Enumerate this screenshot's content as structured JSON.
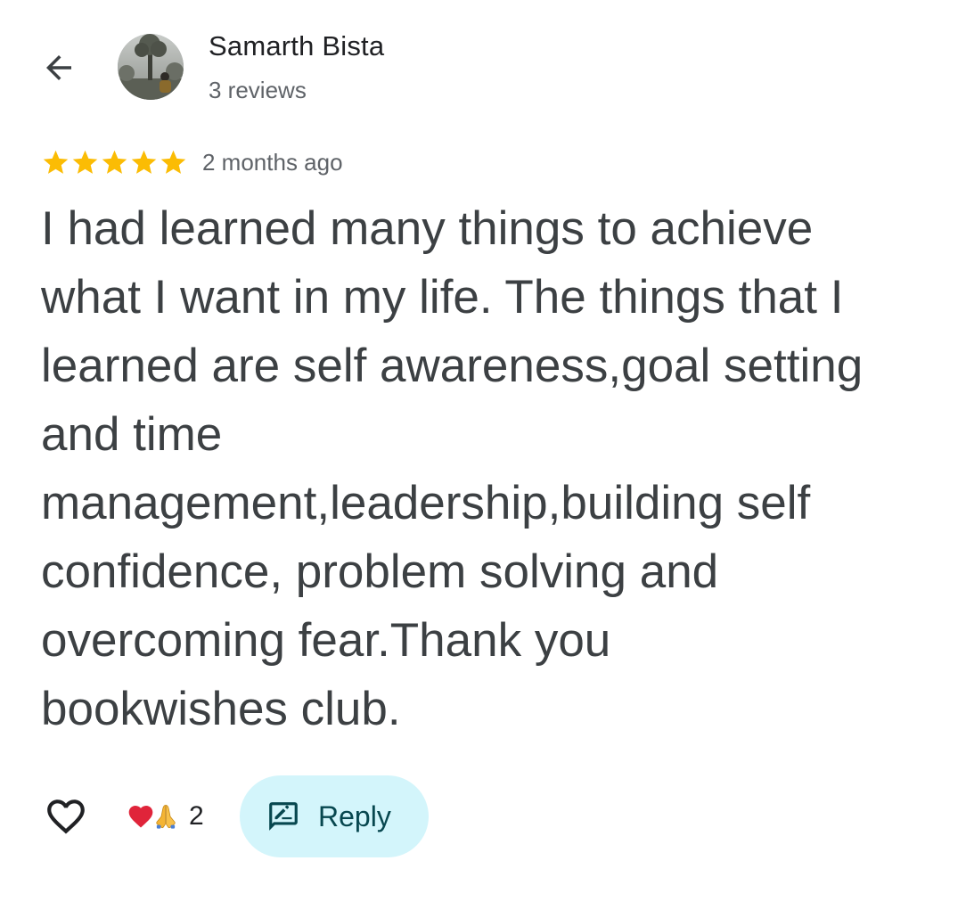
{
  "header": {
    "back_icon": "arrow-left-icon",
    "author_name": "Samarth Bista",
    "review_count": "3 reviews",
    "avatar_icon": "profile-photo"
  },
  "review": {
    "rating": 5,
    "rating_max": 5,
    "star_color": "#fbbc04",
    "date": "2 months ago",
    "text": "I had learned many things to achieve\nwhat I want in my life. The things that I\nlearned are self awareness,goal setting\nand time\nmanagement,leadership,building self\nconfidence, problem solving and\novercoming fear.Thank you\nbookwishes club."
  },
  "actions": {
    "like_icon": "heart-outline-icon",
    "reactions": [
      "red-heart-emoji",
      "folded-hands-emoji"
    ],
    "reaction_count": "2",
    "reply_label": "Reply",
    "reply_icon": "reply-comment-icon",
    "reply_bg_color": "#d3f5fb",
    "reply_text_color": "#07474f"
  }
}
